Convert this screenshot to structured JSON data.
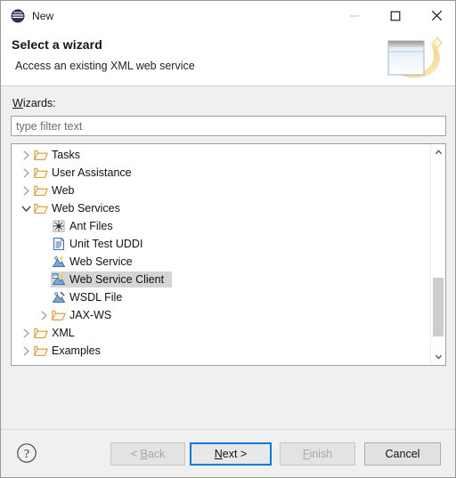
{
  "window": {
    "title": "New",
    "app_icon": "eclipse-sphere-icon",
    "controls": {
      "minimize": "minimize-icon",
      "maximize": "maximize-icon",
      "close": "close-icon"
    }
  },
  "header": {
    "title": "Select a wizard",
    "description": "Access an existing XML web service",
    "banner_icon": "wizard-banner-icon"
  },
  "form": {
    "wizards_label_prefix": "W",
    "wizards_label_rest": "izards:",
    "filter_placeholder": "type filter text",
    "filter_value": ""
  },
  "tree": {
    "items": [
      {
        "label": "Tasks",
        "depth": 0,
        "icon": "folder-icon",
        "twisty": "collapsed",
        "selected": false
      },
      {
        "label": "User Assistance",
        "depth": 0,
        "icon": "folder-icon",
        "twisty": "collapsed",
        "selected": false
      },
      {
        "label": "Web",
        "depth": 0,
        "icon": "folder-icon",
        "twisty": "collapsed",
        "selected": false
      },
      {
        "label": "Web Services",
        "depth": 0,
        "icon": "folder-icon",
        "twisty": "expanded",
        "selected": false
      },
      {
        "label": "Ant Files",
        "depth": 1,
        "icon": "ant-files-icon",
        "twisty": "none",
        "selected": false
      },
      {
        "label": "Unit Test UDDI",
        "depth": 1,
        "icon": "uddi-document-icon",
        "twisty": "none",
        "selected": false
      },
      {
        "label": "Web Service",
        "depth": 1,
        "icon": "web-service-icon",
        "twisty": "none",
        "selected": false
      },
      {
        "label": "Web Service Client",
        "depth": 1,
        "icon": "web-service-client-icon",
        "twisty": "none",
        "selected": true
      },
      {
        "label": "WSDL File",
        "depth": 1,
        "icon": "wsdl-file-icon",
        "twisty": "none",
        "selected": false
      },
      {
        "label": "JAX-WS",
        "depth": 1,
        "icon": "folder-icon",
        "twisty": "collapsed",
        "selected": false
      },
      {
        "label": "XML",
        "depth": 0,
        "icon": "folder-icon",
        "twisty": "collapsed",
        "selected": false
      },
      {
        "label": "Examples",
        "depth": 0,
        "icon": "folder-icon",
        "twisty": "collapsed",
        "selected": false
      }
    ],
    "scrollbar": {
      "up_arrow": "scroll-up-icon",
      "down_arrow": "scroll-down-icon",
      "thumb_top_pct": 62,
      "thumb_height_pct": 31
    }
  },
  "footer": {
    "help_icon": "help-question-icon",
    "buttons": [
      {
        "name": "back",
        "label": "< Back",
        "mnemonic": "B",
        "disabled": true,
        "default": false
      },
      {
        "name": "next",
        "label": "Next >",
        "mnemonic": "N",
        "disabled": false,
        "default": true
      },
      {
        "name": "finish",
        "label": "Finish",
        "mnemonic": "F",
        "disabled": true,
        "default": false
      },
      {
        "name": "cancel",
        "label": "Cancel",
        "mnemonic": "",
        "disabled": false,
        "default": false
      }
    ]
  },
  "colors": {
    "accent": "#0078d7",
    "dialog_bg": "#f0f0f0",
    "list_bg": "#ffffff",
    "selection": "#d5d5d5",
    "folder": "#e8a33d",
    "banner_gold": "#f0d38a"
  }
}
